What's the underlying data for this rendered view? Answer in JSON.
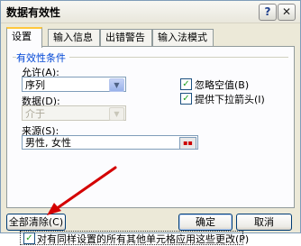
{
  "window": {
    "title": "数据有效性",
    "help_label": "?",
    "close_label": "✕"
  },
  "tabs": [
    {
      "label": "设置",
      "active": true
    },
    {
      "label": "输入信息",
      "active": false
    },
    {
      "label": "出错警告",
      "active": false
    },
    {
      "label": "输入法模式",
      "active": false
    }
  ],
  "settings": {
    "group_label": "有效性条件",
    "allow_label": "允许(A):",
    "allow_value": "序列",
    "data_label": "数据(D):",
    "data_value": "介于",
    "ignore_blank_label": "忽略空值(B)",
    "ignore_blank_checked": "✓",
    "dropdown_label": "提供下拉箭头(I)",
    "dropdown_checked": "✓",
    "source_label": "来源(S):",
    "source_value": "男性, 女性",
    "apply_all_label": "对有同样设置的所有其他单元格应用这些更改(P)",
    "apply_all_checked": "✓"
  },
  "buttons": {
    "clear_all": "全部清除(C)",
    "ok": "确定",
    "cancel": "取消"
  },
  "colors": {
    "group_label": "#0046d5",
    "annotation_arrow": "#d40000"
  },
  "icons": {
    "combo_arrow": "▼",
    "ref_button": "▪▪"
  }
}
